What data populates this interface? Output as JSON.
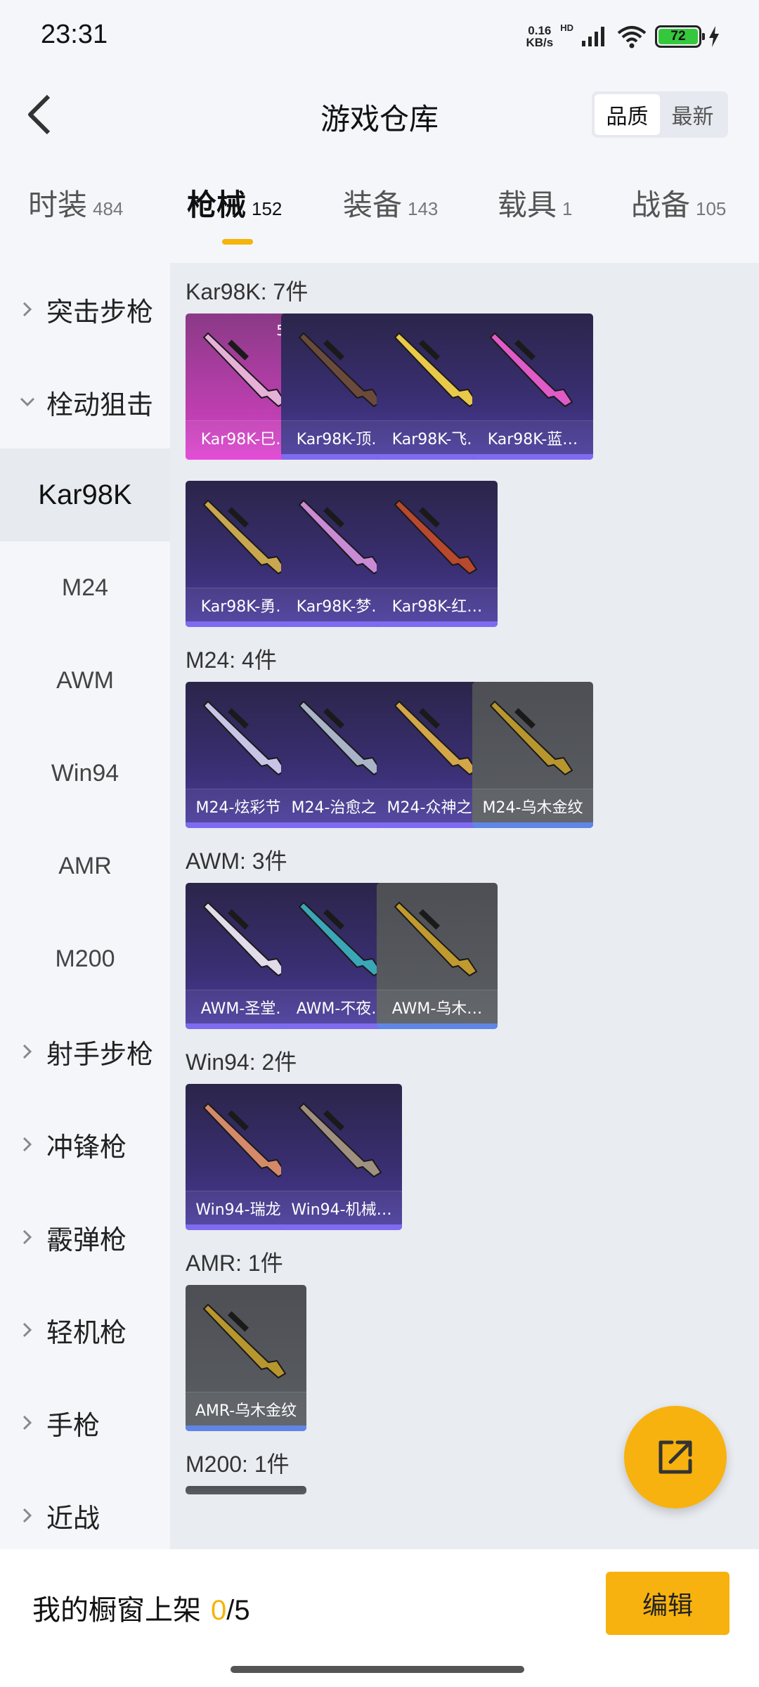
{
  "status_bar": {
    "time": "23:31",
    "net_speed_value": "0.16",
    "net_speed_unit": "KB/s",
    "hd_label": "HD",
    "battery": "72"
  },
  "header": {
    "title": "游戏仓库",
    "sort_options": [
      "品质",
      "最新"
    ],
    "sort_selected": "品质"
  },
  "tabs": [
    {
      "label": "时装",
      "count": "484"
    },
    {
      "label": "枪械",
      "count": "152",
      "active": true
    },
    {
      "label": "装备",
      "count": "143"
    },
    {
      "label": "载具",
      "count": "1"
    },
    {
      "label": "战备",
      "count": "105"
    }
  ],
  "sidebar": {
    "items": [
      {
        "label": "突击步枪",
        "type": "category"
      },
      {
        "label": "栓动狙击",
        "type": "category",
        "expanded": true
      },
      {
        "label": "Kar98K",
        "type": "sub",
        "active": true
      },
      {
        "label": "M24",
        "type": "sub"
      },
      {
        "label": "AWM",
        "type": "sub"
      },
      {
        "label": "Win94",
        "type": "sub"
      },
      {
        "label": "AMR",
        "type": "sub"
      },
      {
        "label": "M200",
        "type": "sub"
      },
      {
        "label": "射手步枪",
        "type": "category"
      },
      {
        "label": "冲锋枪",
        "type": "category"
      },
      {
        "label": "霰弹枪",
        "type": "category"
      },
      {
        "label": "轻机枪",
        "type": "category"
      },
      {
        "label": "手枪",
        "type": "category"
      },
      {
        "label": "近战",
        "type": "category"
      }
    ]
  },
  "groups": [
    {
      "title": "Kar98K: 7件",
      "items": [
        {
          "name": "Kar98K-巳…",
          "style": "pink",
          "level": "5级",
          "accent": "#e6b0d8"
        },
        {
          "name": "Kar98K-顶…",
          "style": "purple",
          "accent": "#6b4a3c"
        },
        {
          "name": "Kar98K-飞…",
          "style": "purple",
          "accent": "#e8c94a"
        },
        {
          "name": "Kar98K-蓝…",
          "style": "purple",
          "accent": "#e05ac8"
        },
        {
          "name": "Kar98K-勇…",
          "style": "purple",
          "accent": "#c9a650"
        },
        {
          "name": "Kar98K-梦…",
          "style": "purple",
          "accent": "#c98ad6"
        },
        {
          "name": "Kar98K-红…",
          "style": "purple",
          "accent": "#b8482e"
        }
      ]
    },
    {
      "title": "M24: 4件",
      "items": [
        {
          "name": "M24-炫彩节奏",
          "style": "purple",
          "accent": "#c8c4e8"
        },
        {
          "name": "M24-治愈之星",
          "style": "purple",
          "accent": "#a9b4c8"
        },
        {
          "name": "M24-众神之王",
          "style": "purple",
          "accent": "#d4a64a"
        },
        {
          "name": "M24-乌木金纹",
          "style": "gray",
          "accent": "#b8962e"
        }
      ]
    },
    {
      "title": "AWM: 3件",
      "items": [
        {
          "name": "AWM-圣堂…",
          "style": "purple",
          "accent": "#e2dcea"
        },
        {
          "name": "AWM-不夜…",
          "style": "purple",
          "accent": "#3aa6b8"
        },
        {
          "name": "AWM-乌木…",
          "style": "gray",
          "accent": "#c09a2e"
        }
      ]
    },
    {
      "title": "Win94: 2件",
      "items": [
        {
          "name": "Win94-瑞龙…",
          "style": "purple",
          "accent": "#d48a6a"
        },
        {
          "name": "Win94-机械…",
          "style": "purple",
          "accent": "#a09080"
        }
      ]
    },
    {
      "title": "AMR: 1件",
      "items": [
        {
          "name": "AMR-乌木金纹",
          "style": "gray",
          "accent": "#b8962e"
        }
      ]
    },
    {
      "title": "M200: 1件",
      "items": []
    }
  ],
  "bottom_bar": {
    "label": "我的橱窗上架",
    "current": "0",
    "total": "/5",
    "edit_label": "编辑"
  }
}
